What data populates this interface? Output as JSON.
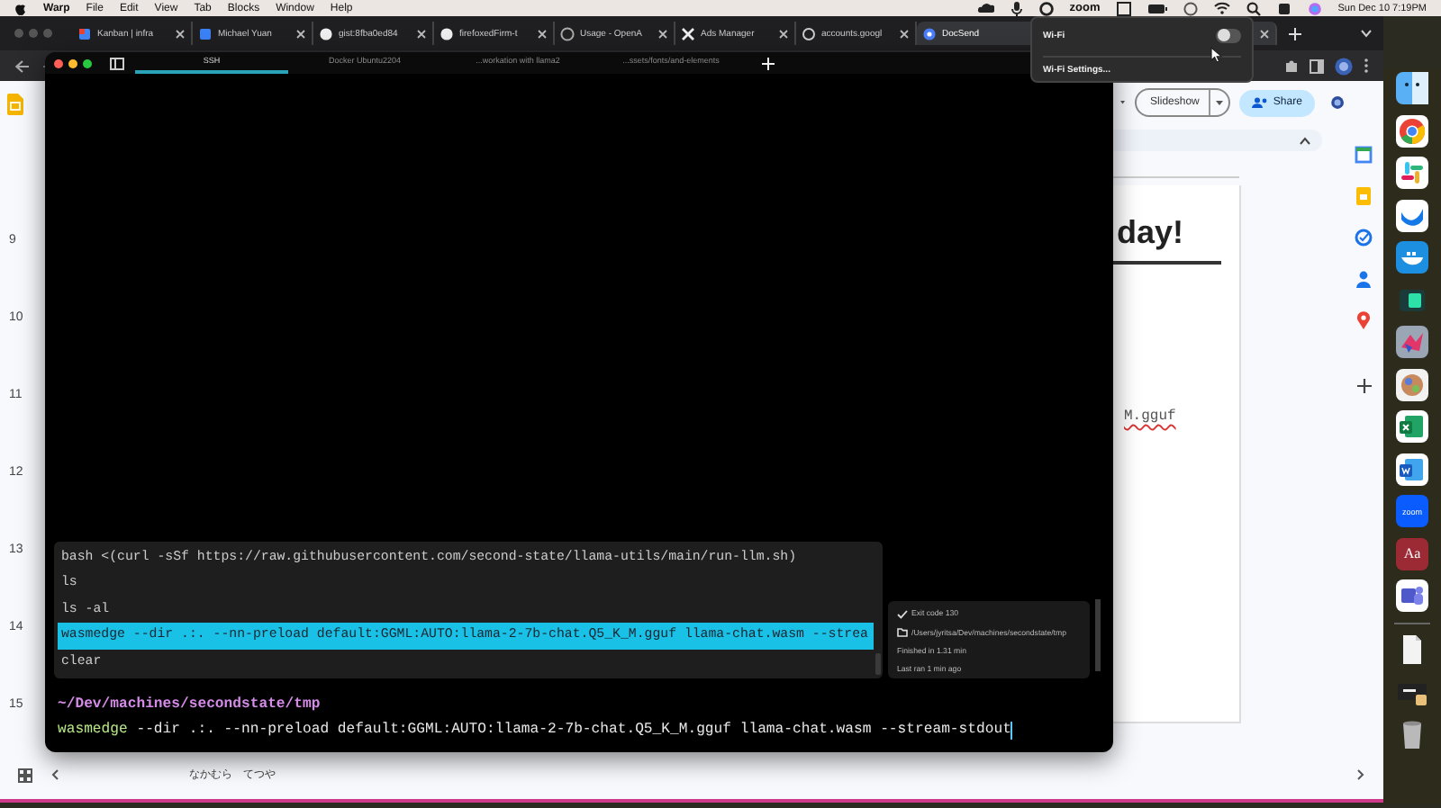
{
  "menubar": {
    "app": "Warp",
    "items": [
      "File",
      "Edit",
      "View",
      "Tab",
      "Blocks",
      "Window",
      "Help"
    ],
    "zoom": "zoom",
    "clock": "Sun Dec 10  7:19PM"
  },
  "browser": {
    "tabs": [
      {
        "label": "Kanban | infra",
        "selected": false
      },
      {
        "label": "Michael Yuan",
        "selected": false
      },
      {
        "label": "gist:8fba0ed84",
        "selected": false
      },
      {
        "label": "firefoxedFirm-t",
        "selected": false
      },
      {
        "label": "Usage - OpenA",
        "selected": false
      },
      {
        "label": "Ads Manager",
        "selected": false
      },
      {
        "label": "accounts.googl",
        "selected": false
      },
      {
        "label": "DocSend",
        "selected": true
      }
    ],
    "slide_numbers": [
      "9",
      "10",
      "11",
      "12",
      "13",
      "14",
      "15"
    ],
    "slideshow": "Slideshow",
    "share": "Share",
    "slide_title": "day!",
    "slide_code": "M.gguf",
    "notes": "なかむら　てつや"
  },
  "terminal": {
    "tabs": [
      {
        "label": "SSH",
        "selected": true
      },
      {
        "label": "Docker Ubuntu2204",
        "selected": false
      },
      {
        "label": "...workation with llama2",
        "selected": false
      },
      {
        "label": "...ssets/fonts/and-elements",
        "selected": false
      }
    ],
    "history": [
      {
        "command": "bash <(curl -sSf https://raw.githubusercontent.com/second-state/llama-utils/main/run-llm.sh)",
        "selected": false
      },
      {
        "command": "ls",
        "selected": false
      },
      {
        "command": "ls -al",
        "selected": false
      },
      {
        "command": "wasmedge --dir .:. --nn-preload default:GGML:AUTO:llama-2-7b-chat.Q5_K_M.gguf llama-chat.wasm --strea",
        "selected": true
      },
      {
        "command": "clear",
        "selected": false
      }
    ],
    "block_info": {
      "exit_code": "Exit code 130",
      "path": "/Users/jyritsa/Dev/machines/secondstate/tmp",
      "finished": "Finished in 1.31 min",
      "last_ran": "Last ran 1 min ago"
    },
    "prompt": {
      "cwd": "~/Dev/machines/secondstate/tmp",
      "program": "wasmedge",
      "args": " --dir .:. --nn-preload default:GGML:AUTO:llama-2-7b-chat.Q5_K_M.gguf llama-chat.wasm --stream-stdout"
    }
  },
  "wifi_menu": {
    "title": "Wi-Fi",
    "on": false,
    "settings": "Wi-Fi Settings..."
  },
  "dock": [
    {
      "kind": "finder"
    },
    {
      "kind": "chrome"
    },
    {
      "kind": "slack"
    },
    {
      "kind": "wave"
    },
    {
      "kind": "docker"
    },
    {
      "kind": "terminal"
    },
    {
      "kind": "bird"
    },
    {
      "kind": "photo"
    },
    {
      "kind": "sheet"
    },
    {
      "kind": "doc"
    },
    {
      "kind": "zoom",
      "label": "zoom"
    },
    {
      "kind": "dictionary",
      "label": "Aa"
    },
    {
      "kind": "teams"
    },
    {
      "kind": "separator"
    },
    {
      "kind": "file"
    },
    {
      "kind": "screen"
    },
    {
      "kind": "trash"
    }
  ]
}
